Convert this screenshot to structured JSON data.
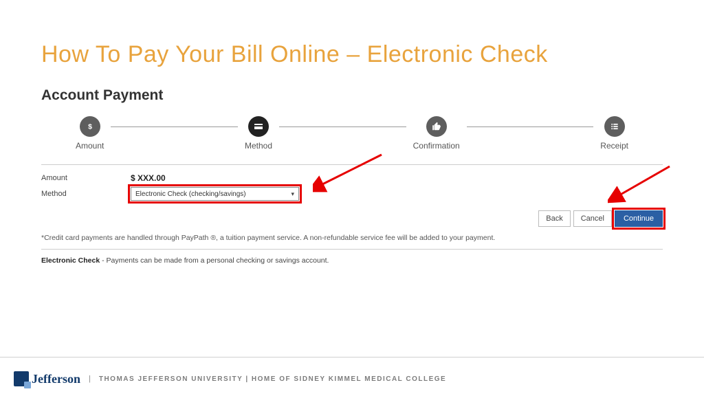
{
  "title": "How To Pay Your Bill Online – Electronic Check",
  "panel_title": "Account Payment",
  "steps": {
    "amount": "Amount",
    "method": "Method",
    "confirmation": "Confirmation",
    "receipt": "Receipt"
  },
  "form": {
    "amount_label": "Amount",
    "amount_value": "$ XXX.00",
    "method_label": "Method",
    "method_selected": "Electronic Check (checking/savings)"
  },
  "buttons": {
    "back": "Back",
    "cancel": "Cancel",
    "continue": "Continue"
  },
  "note": "*Credit card payments are handled through PayPath ®, a tuition payment service. A non-refundable service fee will be added to your payment.",
  "echeck_bold": "Electronic Check",
  "echeck_text": " - Payments can be made from a personal checking or savings account.",
  "footer": {
    "logo": "Jefferson",
    "text": "THOMAS JEFFERSON UNIVERSITY   |   HOME OF SIDNEY KIMMEL MEDICAL COLLEGE"
  }
}
